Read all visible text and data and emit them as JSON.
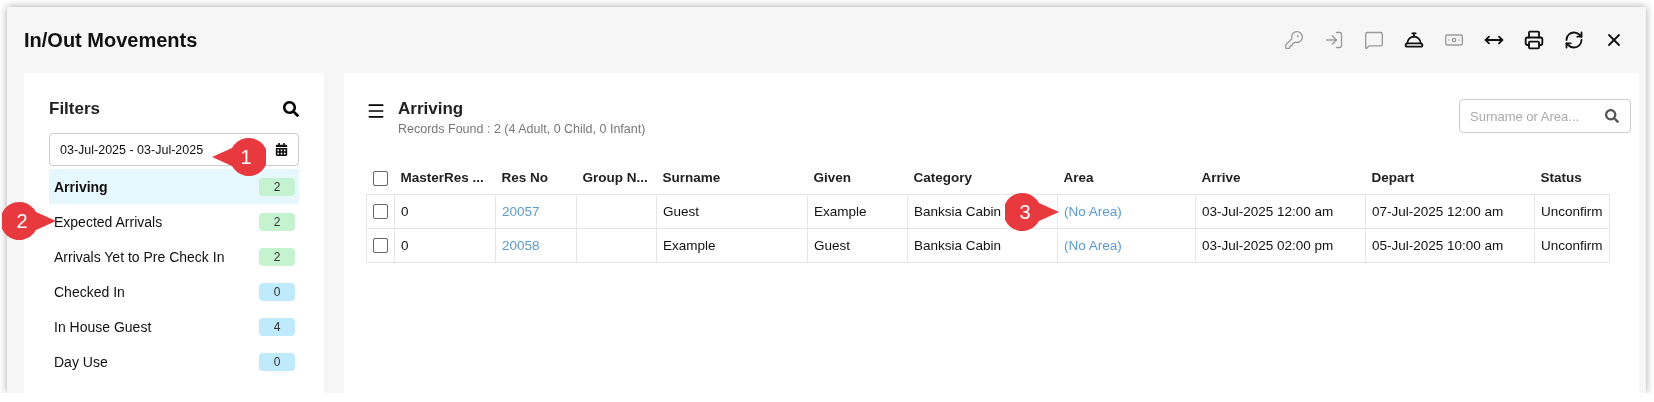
{
  "window": {
    "title": "In/Out Movements"
  },
  "toolbar": [
    {
      "kind": "key",
      "disabled": true
    },
    {
      "kind": "login",
      "disabled": true
    },
    {
      "kind": "message",
      "disabled": true
    },
    {
      "kind": "bell",
      "disabled": false
    },
    {
      "kind": "money",
      "disabled": true
    },
    {
      "kind": "resize",
      "disabled": false
    },
    {
      "kind": "print",
      "disabled": false
    },
    {
      "kind": "refresh",
      "disabled": false
    },
    {
      "kind": "close",
      "disabled": false
    }
  ],
  "filters": {
    "title": "Filters",
    "date_range": "03-Jul-2025 - 03-Jul-2025",
    "items": [
      {
        "label": "Arriving",
        "count": "2",
        "color": "#c6f3cf",
        "selected": true
      },
      {
        "label": "Expected Arrivals",
        "count": "2",
        "color": "#c6f3cf",
        "selected": false
      },
      {
        "label": "Arrivals Yet to Pre Check In",
        "count": "2",
        "color": "#c6f3cf",
        "selected": false
      },
      {
        "label": "Checked In",
        "count": "0",
        "color": "#bfeafb",
        "selected": false
      },
      {
        "label": "In House Guest",
        "count": "4",
        "color": "#bfeafb",
        "selected": false
      },
      {
        "label": "Day Use",
        "count": "0",
        "color": "#bfeafb",
        "selected": false
      }
    ]
  },
  "list": {
    "title": "Arriving",
    "subtitle": "Records Found : 2 (4 Adult, 0 Child, 0 Infant)",
    "search": {
      "placeholder": "Surname or Area..."
    },
    "table": {
      "select_all_checked": false,
      "columns": [
        {
          "label": "MasterRes ...",
          "kind": "text"
        },
        {
          "label": "Res No",
          "kind": "link"
        },
        {
          "label": "Group N...",
          "kind": "text"
        },
        {
          "label": "Surname",
          "kind": "text"
        },
        {
          "label": "Given",
          "kind": "text"
        },
        {
          "label": "Category",
          "kind": "text"
        },
        {
          "label": "Area",
          "kind": "link"
        },
        {
          "label": "Arrive",
          "kind": "text"
        },
        {
          "label": "Depart",
          "kind": "text"
        },
        {
          "label": "Status",
          "kind": "text"
        }
      ],
      "rows": [
        {
          "checked": false,
          "cells": [
            "0",
            "20057",
            "",
            "Guest",
            "Example",
            "Banksia Cabin",
            "(No Area)",
            "03-Jul-2025 12:00 am",
            "07-Jul-2025 12:00 am",
            "Unconfirm"
          ]
        },
        {
          "checked": false,
          "cells": [
            "0",
            "20058",
            "",
            "Example",
            "Guest",
            "Banksia Cabin",
            "(No Area)",
            "03-Jul-2025 02:00 pm",
            "05-Jul-2025 10:00 am",
            "Unconfirm"
          ]
        }
      ]
    }
  },
  "callouts": [
    {
      "label": "1",
      "kind": "left"
    },
    {
      "label": "2",
      "kind": "right"
    },
    {
      "label": "3",
      "kind": "right"
    }
  ]
}
